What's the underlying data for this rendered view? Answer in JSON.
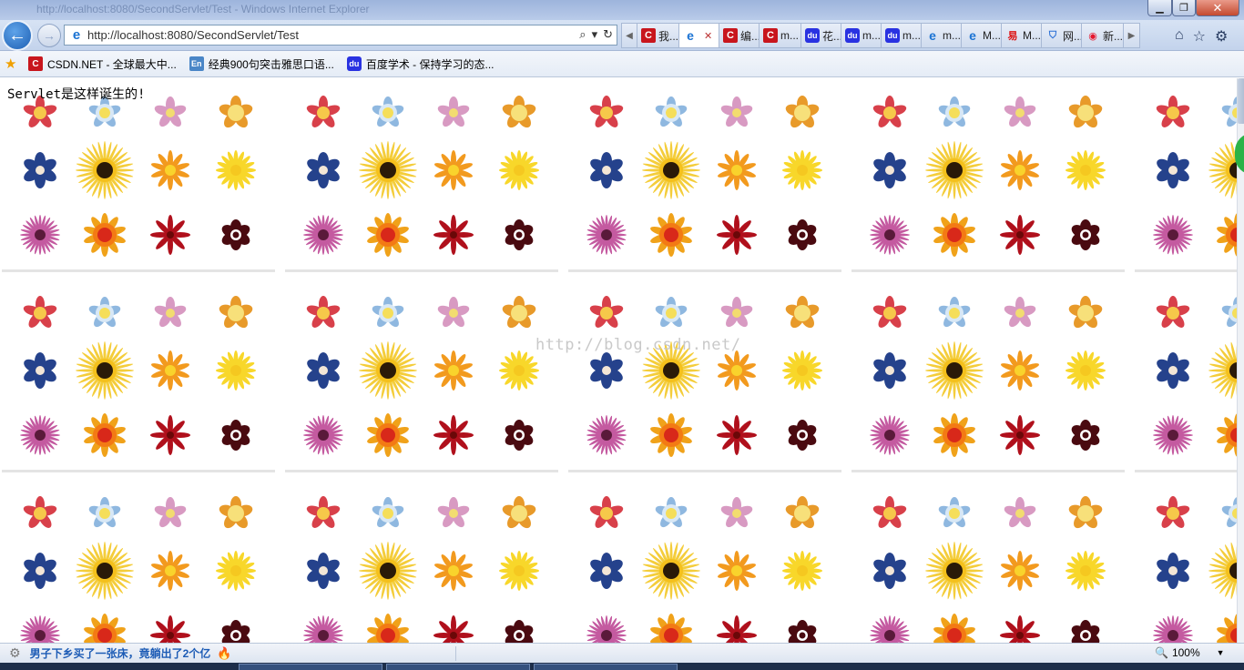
{
  "window": {
    "title": "http://localhost:8080/SecondServlet/Test - Windows Internet Explorer",
    "minimize_glyph": "▁",
    "maximize_glyph": "❐",
    "close_glyph": "✕"
  },
  "nav": {
    "back_glyph": "←",
    "forward_glyph": "→",
    "address": "http://localhost:8080/SecondServlet/Test",
    "search_glyph": "⌕",
    "dropdown_glyph": "▾",
    "refresh_glyph": "↻"
  },
  "tabs": {
    "prev_glyph": "◀",
    "next_glyph": "▶",
    "close_glyph": "✕",
    "items": [
      {
        "icon": "csdn-icon",
        "icon_glyph": "C",
        "label": "我..."
      },
      {
        "icon": "ie-icon",
        "icon_glyph": "e",
        "label": "",
        "active": true
      },
      {
        "icon": "csdn-icon",
        "icon_glyph": "C",
        "label": "编..."
      },
      {
        "icon": "csdn-icon",
        "icon_glyph": "C",
        "label": "m..."
      },
      {
        "icon": "baidu-icon",
        "icon_glyph": "du",
        "label": "花..."
      },
      {
        "icon": "baidu-icon",
        "icon_glyph": "du",
        "label": "m..."
      },
      {
        "icon": "baidu-icon",
        "icon_glyph": "du",
        "label": "m..."
      },
      {
        "icon": "ie-icon",
        "icon_glyph": "e",
        "label": "m..."
      },
      {
        "icon": "ie-icon",
        "icon_glyph": "e",
        "label": "M..."
      },
      {
        "icon": "red-icon",
        "icon_glyph": "易",
        "label": "M..."
      },
      {
        "icon": "shield-icon",
        "icon_glyph": "⛉",
        "label": "网..."
      },
      {
        "icon": "weibo-icon",
        "icon_glyph": "◉",
        "label": "新..."
      }
    ]
  },
  "right_tools": {
    "home_glyph": "⌂",
    "favorites_glyph": "☆",
    "settings_glyph": "⚙"
  },
  "favorites": {
    "star_glyph": "★",
    "items": [
      {
        "icon": "csdn-icon",
        "icon_glyph": "C",
        "label": "CSDN.NET - 全球最大中..."
      },
      {
        "icon": "en-icon",
        "icon_glyph": "En",
        "label": "经典900句突击雅思口语..."
      },
      {
        "icon": "baidu-icon",
        "icon_glyph": "du",
        "label": "百度学术 - 保持学习的态..."
      }
    ]
  },
  "page": {
    "text": "Servlet是这样诞生的!",
    "watermark": "http://blog.csdn.net/"
  },
  "status": {
    "gear_glyph": "⚙",
    "news": "男子下乡买了一张床，竟躺出了2个亿",
    "fire_glyph": "🔥",
    "zoom_glyph": "🔍",
    "zoom": "100%",
    "zoom_arrow": "▼"
  },
  "colors": {
    "flower_red": "#d8404a",
    "flower_lightblue": "#8fb8e0",
    "flower_pink": "#d89ac2",
    "flower_orange": "#e89a2a",
    "flower_navy": "#25428c",
    "flower_yellow": "#f3c826",
    "flower_magenta": "#c45aa0",
    "flower_crimson": "#b0101c",
    "flower_maroon": "#4a0a10"
  }
}
